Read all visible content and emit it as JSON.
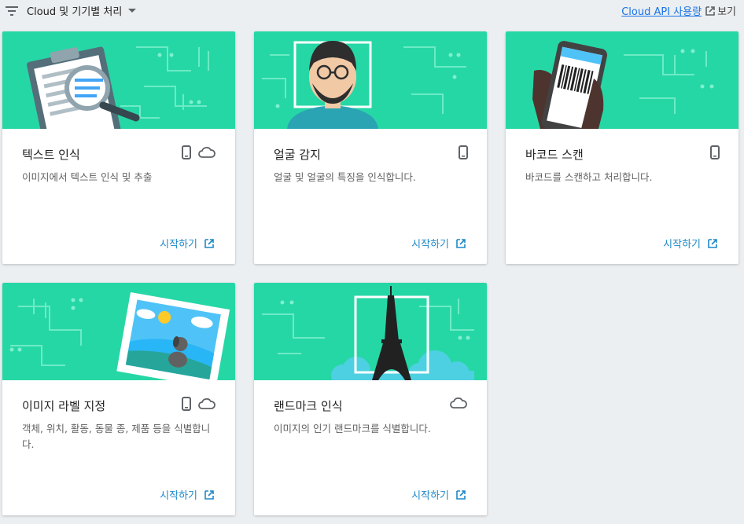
{
  "toolbar": {
    "filter_label": "Cloud 및 기기별 처리",
    "api_link_label": "Cloud API 사용량",
    "api_view_label": "보기"
  },
  "colors": {
    "hero_bg": "#26d7a6",
    "link": "#1e88c7",
    "api_link": "#1a73e8"
  },
  "cards": [
    {
      "title": "텍스트 인식",
      "description": "이미지에서 텍스트 인식 및 추출",
      "start_label": "시작하기",
      "badges": [
        "phone-icon",
        "cloud-icon"
      ]
    },
    {
      "title": "얼굴 감지",
      "description": "얼굴 및 얼굴의 특징을 인식합니다.",
      "start_label": "시작하기",
      "badges": [
        "phone-icon"
      ]
    },
    {
      "title": "바코드 스캔",
      "description": "바코드를 스캔하고 처리합니다.",
      "start_label": "시작하기",
      "badges": [
        "phone-icon"
      ]
    },
    {
      "title": "이미지 라벨 지정",
      "description": "객체, 위치, 활동, 동물 종, 제품 등을 식별합니다.",
      "start_label": "시작하기",
      "badges": [
        "phone-icon",
        "cloud-icon"
      ]
    },
    {
      "title": "랜드마크 인식",
      "description": "이미지의 인기 랜드마크를 식별합니다.",
      "start_label": "시작하기",
      "badges": [
        "cloud-icon"
      ]
    }
  ]
}
